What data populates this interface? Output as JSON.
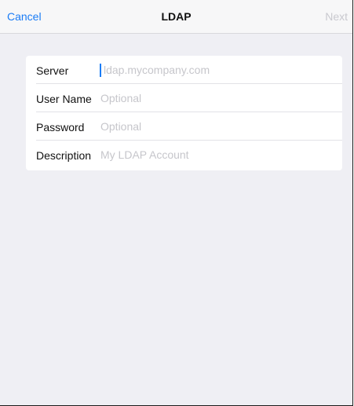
{
  "nav": {
    "cancel_label": "Cancel",
    "title": "LDAP",
    "next_label": "Next"
  },
  "form": {
    "rows": [
      {
        "label": "Server",
        "placeholder": "ldap.mycompany.com",
        "value": ""
      },
      {
        "label": "User Name",
        "placeholder": "Optional",
        "value": ""
      },
      {
        "label": "Password",
        "placeholder": "Optional",
        "value": ""
      },
      {
        "label": "Description",
        "placeholder": "My LDAP Account",
        "value": ""
      }
    ]
  },
  "colors": {
    "accent": "#1a7cf6",
    "background": "#efeff4",
    "placeholder": "#c6c6cb",
    "disabled": "#c9c9cf"
  }
}
